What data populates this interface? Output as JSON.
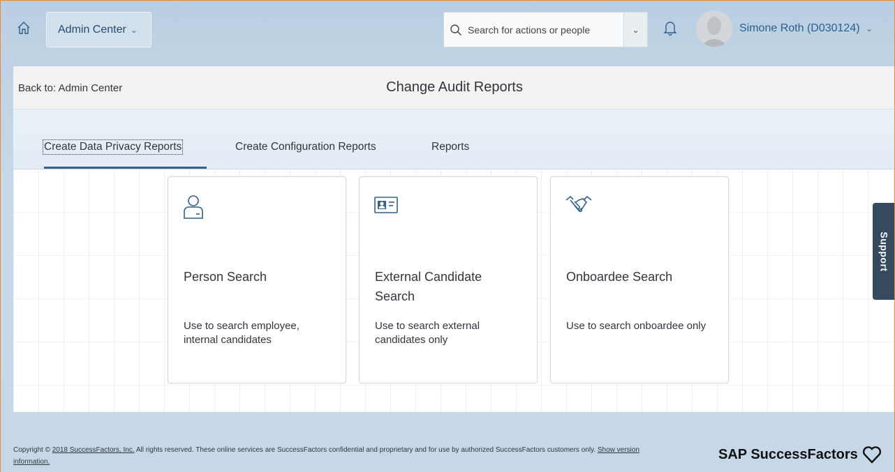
{
  "shell": {
    "home_icon": "home-icon",
    "admin_menu_label": "Admin Center",
    "search_placeholder": "Search for actions or people",
    "notification_icon": "bell-icon",
    "user_name": "Simone Roth (D030124)"
  },
  "page_header": {
    "back_link": "Back to: Admin Center",
    "title": "Change Audit Reports"
  },
  "tabs": [
    {
      "label": "Create Data Privacy Reports",
      "selected": true
    },
    {
      "label": "Create Configuration Reports",
      "selected": false
    },
    {
      "label": "Reports",
      "selected": false
    }
  ],
  "cards": [
    {
      "icon": "person-icon",
      "title": "Person Search",
      "description": "Use to search employee, internal candidates"
    },
    {
      "icon": "id-card-icon",
      "title": "External Candidate Search",
      "description": "Use to search external candidates only"
    },
    {
      "icon": "handshake-icon",
      "title": "Onboardee Search",
      "description": "Use to search onboardee only"
    }
  ],
  "support_label": "Support",
  "footer": {
    "copyright_prefix": "Copyright ©",
    "copyright_link": "2018 SuccessFactors, Inc.",
    "copyright_rest": "All rights reserved. These online services are SuccessFactors confidential and proprietary and for use by authorized SuccessFactors customers only.",
    "version_link": "Show version information.",
    "brand": "SAP SuccessFactors"
  },
  "colors": {
    "accent": "#346187",
    "frame_border": "#e8893a",
    "support_bg": "#354a5f"
  }
}
